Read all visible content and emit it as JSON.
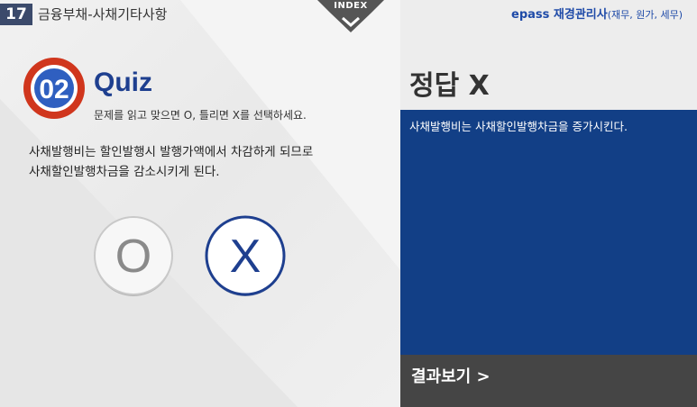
{
  "header": {
    "chapter_number": "17",
    "chapter_title": "금융부채-사채기타사항",
    "index_label": "INDEX"
  },
  "quiz": {
    "number": "02",
    "title": "Quiz",
    "instruction": "문제를 읽고 맞으면 O, 틀리면 X를 선택하세요.",
    "question_line1": "사채발행비는 할인발행시 발행가액에서 차감하게 되므로",
    "question_line2": "사채할인발행차금을 감소시키게 된다.",
    "answer_o": "O",
    "answer_x": "X"
  },
  "brand": {
    "name": "epass 재경관리사",
    "sub": "(재무, 원가, 세무)"
  },
  "result": {
    "title": "정답 X",
    "explanation": "사채발행비는 사채할인발행차금을 증가시킨다.",
    "view_result_label": "결과보기 >"
  },
  "colors": {
    "chapter_badge": "#3b4a6b",
    "quiz_blue": "#1e3f8f",
    "badge_red": "#d0361d",
    "explain_panel": "#123f86",
    "result_button": "#454545",
    "brand": "#1e4aa8"
  }
}
